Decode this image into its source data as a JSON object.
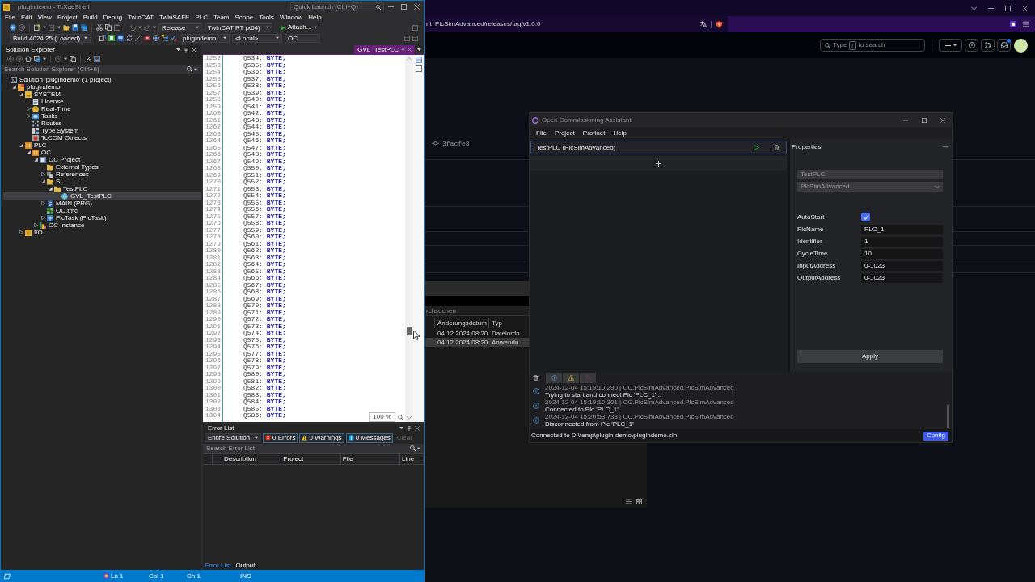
{
  "ide": {
    "title": "plugindemo - TcXaeShell",
    "quick_launch": {
      "placeholder": "Quick Launch (Ctrl+Q)"
    },
    "menu": [
      "File",
      "Edit",
      "View",
      "Project",
      "Build",
      "Debug",
      "TwinCAT",
      "TwinSAFE",
      "PLC",
      "Team",
      "Scope",
      "Tools",
      "Window",
      "Help"
    ],
    "toolbar": {
      "configuration": "Release",
      "platform": "TwinCAT RT (x64)",
      "attach": "Attach...",
      "build": "Build 4024.25 (Loaded)",
      "project": "plugindemo",
      "target": "<Local>",
      "plc": "OC"
    },
    "solution_explorer": {
      "title": "Solution Explorer",
      "search": {
        "placeholder": "Search Solution Explorer (Ctrl+ü)"
      },
      "tree": [
        {
          "label": "Solution 'plugindemo' (1 project)",
          "kind": "solution",
          "selected": false,
          "children": [
            {
              "label": "plugindemo",
              "kind": "project",
              "expanded": true,
              "selected": false,
              "children": [
                {
                  "label": "SYSTEM",
                  "kind": "system",
                  "expanded": true,
                  "selected": false,
                  "children": [
                    {
                      "label": "License",
                      "kind": "license",
                      "selected": false
                    },
                    {
                      "label": "Real-Time",
                      "kind": "realtime",
                      "expanded": false,
                      "selected": false
                    },
                    {
                      "label": "Tasks",
                      "kind": "tasks",
                      "expanded": false,
                      "selected": false
                    },
                    {
                      "label": "Routes",
                      "kind": "routes",
                      "selected": false
                    },
                    {
                      "label": "Type System",
                      "kind": "types",
                      "selected": false
                    },
                    {
                      "label": "TcCOM Objects",
                      "kind": "tccom",
                      "selected": false
                    }
                  ]
                },
                {
                  "label": "PLC",
                  "kind": "plc",
                  "expanded": true,
                  "selected": false,
                  "children": [
                    {
                      "label": "OC",
                      "kind": "plc",
                      "expanded": true,
                      "selected": false,
                      "children": [
                        {
                          "label": "OC Project",
                          "kind": "plcproject",
                          "expanded": true,
                          "selected": false,
                          "children": [
                            {
                              "label": "External Types",
                              "kind": "folder",
                              "selected": false
                            },
                            {
                              "label": "References",
                              "kind": "references",
                              "expanded": false,
                              "selected": false
                            },
                            {
                              "label": "SI",
                              "kind": "folder",
                              "expanded": true,
                              "selected": false,
                              "children": [
                                {
                                  "label": "TestPLC",
                                  "kind": "folder",
                                  "expanded": true,
                                  "selected": false,
                                  "children": [
                                    {
                                      "label": "GVL_TestPLC",
                                      "kind": "gvl",
                                      "selected": true
                                    }
                                  ]
                                }
                              ]
                            },
                            {
                              "label": "MAIN (PRG)",
                              "kind": "pou",
                              "expanded": false,
                              "selected": false
                            },
                            {
                              "label": "OC.tmc",
                              "kind": "tmc",
                              "selected": false
                            },
                            {
                              "label": "PlcTask (PlcTask)",
                              "kind": "task",
                              "expanded": false,
                              "selected": false
                            }
                          ]
                        },
                        {
                          "label": "OC Instance",
                          "kind": "instance",
                          "expanded": false,
                          "selected": false
                        }
                      ]
                    }
                  ]
                },
                {
                  "label": "I/O",
                  "kind": "io",
                  "expanded": false,
                  "selected": false
                }
              ]
            }
          ]
        }
      ]
    },
    "editor": {
      "tabs": [
        {
          "label": "GVL_TestPLC",
          "selected": true
        }
      ],
      "lines": [
        {
          "number": "1252",
          "code": "Q534: **BYTE;**"
        },
        {
          "number": "1253",
          "code": "Q535: **BYTE;**"
        },
        {
          "number": "1254",
          "code": "Q536: **BYTE;**"
        },
        {
          "number": "1255",
          "code": "Q537: **BYTE;**"
        },
        {
          "number": "1256",
          "code": "Q538: **BYTE;**"
        },
        {
          "number": "1257",
          "code": "Q539: **BYTE;**"
        },
        {
          "number": "1258",
          "code": "Q540: **BYTE;**"
        },
        {
          "number": "1259",
          "code": "Q541: **BYTE;**"
        },
        {
          "number": "1260",
          "code": "Q542: **BYTE;**"
        },
        {
          "number": "1261",
          "code": "Q543: **BYTE;**"
        },
        {
          "number": "1262",
          "code": "Q544: **BYTE;**"
        },
        {
          "number": "1263",
          "code": "Q545: **BYTE;**"
        },
        {
          "number": "1264",
          "code": "Q546: **BYTE;**"
        },
        {
          "number": "1265",
          "code": "Q547: **BYTE;**"
        },
        {
          "number": "1266",
          "code": "Q548: **BYTE;**"
        },
        {
          "number": "1267",
          "code": "Q549: **BYTE;**"
        },
        {
          "number": "1268",
          "code": "Q550: **BYTE;**"
        },
        {
          "number": "1269",
          "code": "Q551: **BYTE;**"
        },
        {
          "number": "1270",
          "code": "Q552: **BYTE;**"
        },
        {
          "number": "1271",
          "code": "Q553: **BYTE;**"
        },
        {
          "number": "1272",
          "code": "Q554: **BYTE;**"
        },
        {
          "number": "1273",
          "code": "Q555: **BYTE;**"
        },
        {
          "number": "1274",
          "code": "Q556: **BYTE;**"
        },
        {
          "number": "1275",
          "code": "Q557: **BYTE;**"
        },
        {
          "number": "1276",
          "code": "Q558: **BYTE;**"
        },
        {
          "number": "1277",
          "code": "Q559: **BYTE;**"
        },
        {
          "number": "1278",
          "code": "Q560: **BYTE;**"
        },
        {
          "number": "1279",
          "code": "Q561: **BYTE;**"
        },
        {
          "number": "1280",
          "code": "Q562: **BYTE;**"
        },
        {
          "number": "1281",
          "code": "Q563: **BYTE;**"
        },
        {
          "number": "1282",
          "code": "Q564: **BYTE;**"
        },
        {
          "number": "1283",
          "code": "Q565: **BYTE;**"
        },
        {
          "number": "1284",
          "code": "Q566: **BYTE;**"
        },
        {
          "number": "1285",
          "code": "Q567: **BYTE;**"
        },
        {
          "number": "1286",
          "code": "Q568: **BYTE;**"
        },
        {
          "number": "1287",
          "code": "Q569: **BYTE;**"
        },
        {
          "number": "1288",
          "code": "Q570: **BYTE;**"
        },
        {
          "number": "1289",
          "code": "Q571: **BYTE;**"
        },
        {
          "number": "1290",
          "code": "Q572: **BYTE;**"
        },
        {
          "number": "1291",
          "code": "Q573: **BYTE;**"
        },
        {
          "number": "1292",
          "code": "Q574: **BYTE;**"
        },
        {
          "number": "1293",
          "code": "Q575: **BYTE;**"
        },
        {
          "number": "1294",
          "code": "Q576: **BYTE;**"
        },
        {
          "number": "1295",
          "code": "Q577: **BYTE;**"
        },
        {
          "number": "1296",
          "code": "Q578: **BYTE;**"
        },
        {
          "number": "1297",
          "code": "Q579: **BYTE;**"
        },
        {
          "number": "1298",
          "code": "Q580: **BYTE;**"
        },
        {
          "number": "1299",
          "code": "Q581: **BYTE;**"
        },
        {
          "number": "1300",
          "code": "Q582: **BYTE;**"
        },
        {
          "number": "1301",
          "code": "Q583: **BYTE;**"
        },
        {
          "number": "1302",
          "code": "Q584: **BYTE;**"
        },
        {
          "number": "1303",
          "code": "Q585: **BYTE;**"
        },
        {
          "number": "1304",
          "code": "Q586: **BYTE;**"
        }
      ],
      "zoom": "100 %"
    },
    "error_list": {
      "title": "Error List",
      "scope": "Entire Solution",
      "filters": [
        {
          "kind": "error",
          "label": "0 Errors",
          "selected": true
        },
        {
          "kind": "warning",
          "label": "0 Warnings",
          "selected": true
        },
        {
          "kind": "message",
          "label": "0 Messages",
          "selected": true
        }
      ],
      "clear": {
        "label": "Clear",
        "disabled": true
      },
      "search": {
        "placeholder": "Search Error List"
      },
      "columns": [
        "Description",
        "Project",
        "File",
        "Line"
      ],
      "tabs": [
        {
          "label": "Error List",
          "selected": true
        },
        {
          "label": "Output",
          "selected": false
        }
      ]
    },
    "status_bar": {
      "line": "Ln 1",
      "column": "Col 1",
      "char": "Ch 1",
      "mode": "INS"
    }
  },
  "browser": {
    "url": "nt_PlcSimAdvanced/releases/tag/v1.0.0",
    "search": {
      "prefix": "Type",
      "key": "/",
      "suffix": "to search"
    },
    "commit": "3facfe8"
  },
  "file_explorer": {
    "search": {
      "placeholder": "rchsuchen"
    },
    "columns": [
      "Änderungsdatum",
      "Typ"
    ],
    "rows": [
      {
        "modified": "04.12.2024 08:20",
        "type": "Dateiordn",
        "selected": false
      },
      {
        "modified": "04.12.2024 08:20",
        "type": "Anwendu",
        "selected": true
      }
    ]
  },
  "oc": {
    "title": "Open Commissioning Assistant",
    "menu": [
      "File",
      "Project",
      "Profinet",
      "Help"
    ],
    "plcs": [
      {
        "label": "TestPLC (PlcSimAdvanced)",
        "selected": true
      }
    ],
    "properties": {
      "title": "Properties",
      "name": "TestPLC",
      "type": "PlcSimAdvanced",
      "fields": [
        {
          "kind": "checkbox",
          "label": "AutoStart",
          "checked": true
        },
        {
          "kind": "text",
          "label": "PlcName",
          "value": "PLC_1"
        },
        {
          "kind": "text",
          "label": "Identifier",
          "value": "1"
        },
        {
          "kind": "text",
          "label": "CycleTime",
          "value": "10"
        },
        {
          "kind": "text",
          "label": "InputAddress",
          "value": "0-1023"
        },
        {
          "kind": "text",
          "label": "OutputAddress",
          "value": "0-1023"
        }
      ],
      "apply": "Apply"
    },
    "log_filters": [
      {
        "kind": "info",
        "selected": true
      },
      {
        "kind": "warning",
        "selected": true
      },
      {
        "kind": "error",
        "selected": false
      }
    ],
    "log": [
      {
        "kind": "info",
        "source": "2024-12-04 15:19:10.290 | OC.PlcSimAdvanced.PlcSimAdvanced",
        "message": "Trying to start and connect Plc 'PLC_1'..."
      },
      {
        "kind": "info",
        "source": "2024-12-04 15:19:10.301 | OC.PlcSimAdvanced.PlcSimAdvanced",
        "message": "Connected to Plc 'PLC_1'"
      },
      {
        "kind": "info",
        "source": "2024-12-04 15:20:53.738 | OC.PlcSimAdvanced.PlcSimAdvanced",
        "message": "Disconnected from Plc 'PLC_1'"
      }
    ],
    "status": "Connected to D:\\temp\\plugin-demo\\plugindemo.sln",
    "config": "Config"
  }
}
